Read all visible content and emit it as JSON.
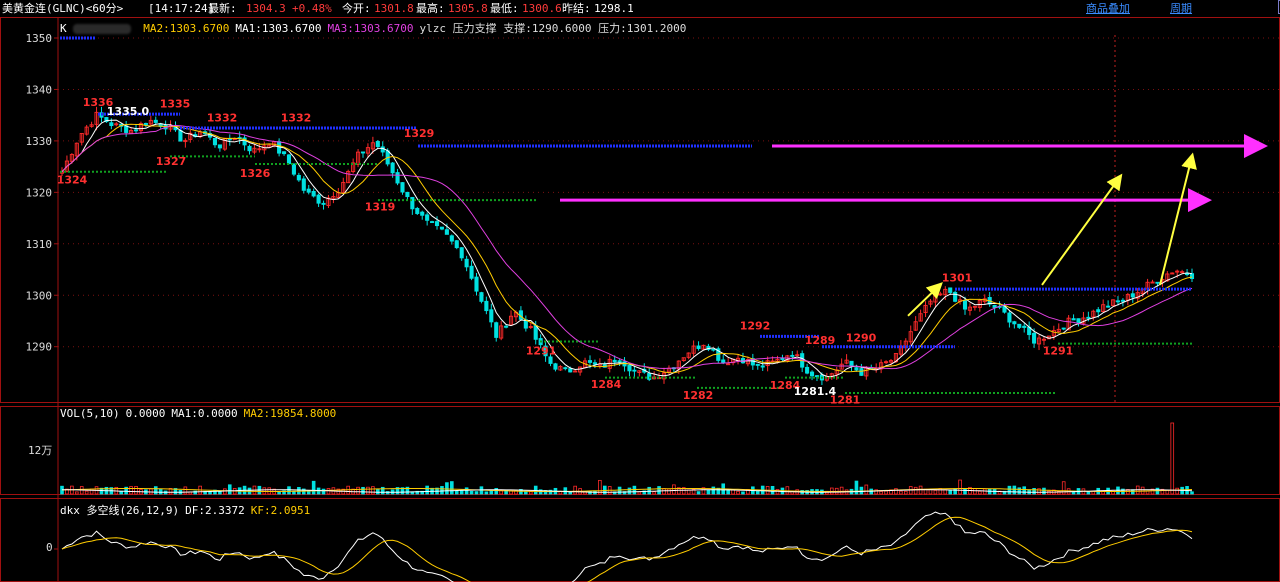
{
  "header": {
    "instrument": "美黄金连(GLNC)<60分>",
    "time": "[14:17:24]",
    "latest_label": "最新:",
    "latest_value": "1304.3",
    "change_value": "+0.48%",
    "open_label": "今开:",
    "open_value": "1301.8",
    "high_label": "最高:",
    "high_value": "1305.8",
    "low_label": "最低:",
    "low_value": "1300.6",
    "prev_label": "昨结:",
    "prev_value": "1298.1",
    "overlay_link": "商品叠加",
    "period_link": "周期"
  },
  "toolbar": {
    "buttons": [
      "⊟",
      "⊞",
      "⊟",
      "⊞"
    ]
  },
  "price_panel": {
    "prefix": "K",
    "ma2": "MA2:1303.6700",
    "ma1": "MA1:1303.6700",
    "ma3": "MA3:1303.6700",
    "indicator": "ylzc 压力支撑 支撑:1290.6000 压力:1301.2000",
    "y_ticks": [
      "1350",
      "1340",
      "1330",
      "1320",
      "1310",
      "1300",
      "1290"
    ],
    "y_tick_values": [
      1350,
      1340,
      1330,
      1320,
      1310,
      1300,
      1290
    ],
    "annotations": [
      {
        "text": "1336",
        "x": 98,
        "price": 1336.8,
        "color": "#ff3030"
      },
      {
        "text": "1335.0",
        "x": 128,
        "price": 1335.0,
        "color": "#ffffff"
      },
      {
        "text": "1335",
        "x": 175,
        "price": 1336.5,
        "color": "#ff3030"
      },
      {
        "text": "1332",
        "x": 222,
        "price": 1333.8,
        "color": "#ff3030"
      },
      {
        "text": "1332",
        "x": 296,
        "price": 1333.8,
        "color": "#ff3030"
      },
      {
        "text": "1329",
        "x": 419,
        "price": 1330.8,
        "color": "#ff3030"
      },
      {
        "text": "1327",
        "x": 171,
        "price": 1325.3,
        "color": "#ff3030"
      },
      {
        "text": "1324",
        "x": 72,
        "price": 1321.7,
        "color": "#ff3030"
      },
      {
        "text": "1326",
        "x": 255,
        "price": 1323.0,
        "color": "#ff3030"
      },
      {
        "text": "1319",
        "x": 380,
        "price": 1316.5,
        "color": "#ff3030"
      },
      {
        "text": "1291",
        "x": 541,
        "price": 1288.5,
        "color": "#ff3030"
      },
      {
        "text": "1284",
        "x": 606,
        "price": 1282.0,
        "color": "#ff3030"
      },
      {
        "text": "1282",
        "x": 698,
        "price": 1279.8,
        "color": "#ff3030"
      },
      {
        "text": "1292",
        "x": 755,
        "price": 1293.3,
        "color": "#ff3030"
      },
      {
        "text": "1289",
        "x": 820,
        "price": 1290.5,
        "color": "#ff3030"
      },
      {
        "text": "1290",
        "x": 861,
        "price": 1291.0,
        "color": "#ff3030"
      },
      {
        "text": "1284",
        "x": 785,
        "price": 1281.8,
        "color": "#ff3030"
      },
      {
        "text": "1281.4",
        "x": 815,
        "price": 1280.6,
        "color": "#ffffff"
      },
      {
        "text": "1281",
        "x": 845,
        "price": 1279.0,
        "color": "#ff3030"
      },
      {
        "text": "1301",
        "x": 957,
        "price": 1302.7,
        "color": "#ff3030"
      },
      {
        "text": "1291",
        "x": 1058,
        "price": 1288.5,
        "color": "#ff3030"
      }
    ]
  },
  "volume_panel": {
    "label": "VOL(5,10)",
    "value": "0.0000",
    "ma1": "MA1:0.0000",
    "ma2": "MA2:19854.8000",
    "y_tick": "12万"
  },
  "dkx_panel": {
    "label": "dkx 多空线(26,12,9)",
    "df": "DF:2.3372",
    "kf": "KF:2.0951",
    "y_tick": "0"
  },
  "colors": {
    "up": "#ff2a2a",
    "down": "#00e0e0",
    "ma1": "#ffffff",
    "ma2": "#ffcc00",
    "ma3": "#e040e0",
    "resistance": "#2030ff",
    "support": "#10a020",
    "arrow_magenta": "#ff30ff",
    "arrow_yellow": "#ffff40",
    "grid": "#7a1010",
    "axis": "#a01010"
  },
  "chart_data": {
    "type": "candlestick",
    "series": [
      {
        "name": "K",
        "points": [
          [
            1324,
            1331
          ],
          [
            1331,
            1335
          ],
          [
            1335,
            1333
          ],
          [
            1333,
            1332
          ],
          [
            1332,
            1334
          ],
          [
            1334,
            1333
          ],
          [
            1333,
            1330
          ],
          [
            1330,
            1332
          ],
          [
            1332,
            1329
          ],
          [
            1329,
            1331
          ],
          [
            1331,
            1328
          ],
          [
            1328,
            1330
          ],
          [
            1330,
            1326
          ],
          [
            1326,
            1320
          ],
          [
            1320,
            1318
          ],
          [
            1318,
            1321
          ],
          [
            1321,
            1327
          ],
          [
            1327,
            1330
          ],
          [
            1330,
            1324
          ],
          [
            1324,
            1318
          ],
          [
            1318,
            1314
          ],
          [
            1314,
            1312
          ],
          [
            1312,
            1308
          ],
          [
            1308,
            1300
          ],
          [
            1300,
            1292
          ],
          [
            1292,
            1297
          ],
          [
            1297,
            1293
          ],
          [
            1293,
            1287
          ],
          [
            1287,
            1285
          ],
          [
            1285,
            1287
          ],
          [
            1287,
            1286
          ],
          [
            1286,
            1288
          ],
          [
            1288,
            1285
          ],
          [
            1285,
            1284
          ],
          [
            1284,
            1286
          ],
          [
            1286,
            1289
          ],
          [
            1289,
            1291
          ],
          [
            1291,
            1287
          ],
          [
            1287,
            1288
          ],
          [
            1288,
            1286
          ],
          [
            1286,
            1287
          ],
          [
            1287,
            1289
          ],
          [
            1289,
            1285
          ],
          [
            1285,
            1284
          ],
          [
            1284,
            1287
          ],
          [
            1287,
            1285
          ],
          [
            1285,
            1286
          ],
          [
            1286,
            1288
          ],
          [
            1288,
            1294
          ],
          [
            1294,
            1299
          ],
          [
            1299,
            1301
          ],
          [
            1301,
            1297
          ],
          [
            1297,
            1299
          ],
          [
            1299,
            1297
          ],
          [
            1297,
            1294
          ],
          [
            1294,
            1291
          ],
          [
            1291,
            1293
          ],
          [
            1293,
            1295
          ],
          [
            1295,
            1296
          ],
          [
            1296,
            1298
          ],
          [
            1298,
            1299
          ],
          [
            1299,
            1301
          ],
          [
            1301,
            1303
          ],
          [
            1303,
            1305
          ],
          [
            1305,
            1304
          ]
        ]
      }
    ]
  }
}
